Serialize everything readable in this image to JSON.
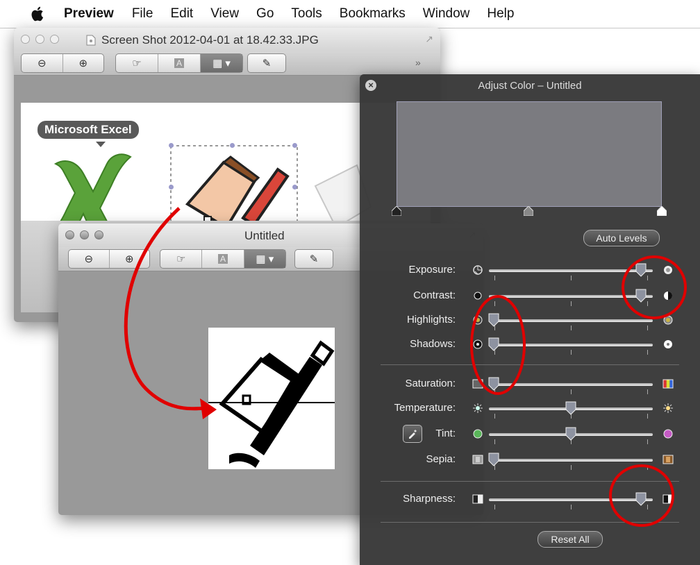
{
  "menubar": {
    "app": "Preview",
    "items": [
      "File",
      "Edit",
      "View",
      "Go",
      "Tools",
      "Bookmarks",
      "Window",
      "Help"
    ]
  },
  "back_window": {
    "title": "Screen Shot 2012-04-01 at 18.42.33.JPG",
    "tooltip": "Microsoft Excel"
  },
  "front_window": {
    "title": "Untitled"
  },
  "adjust_panel": {
    "title": "Adjust Color – Untitled",
    "auto_levels": "Auto Levels",
    "reset_all": "Reset All",
    "sliders": [
      {
        "label": "Exposure:",
        "value": 0.93
      },
      {
        "label": "Contrast:",
        "value": 0.93
      },
      {
        "label": "Highlights:",
        "value": 0.03
      },
      {
        "label": "Shadows:",
        "value": 0.03
      },
      {
        "label": "Saturation:",
        "value": 0.03
      },
      {
        "label": "Temperature:",
        "value": 0.5
      },
      {
        "label": "Tint:",
        "value": 0.5
      },
      {
        "label": "Sepia:",
        "value": 0.03
      },
      {
        "label": "Sharpness:",
        "value": 0.93
      }
    ]
  },
  "colors": {
    "annotation": "#e00000",
    "hud_bg": "#373737"
  }
}
